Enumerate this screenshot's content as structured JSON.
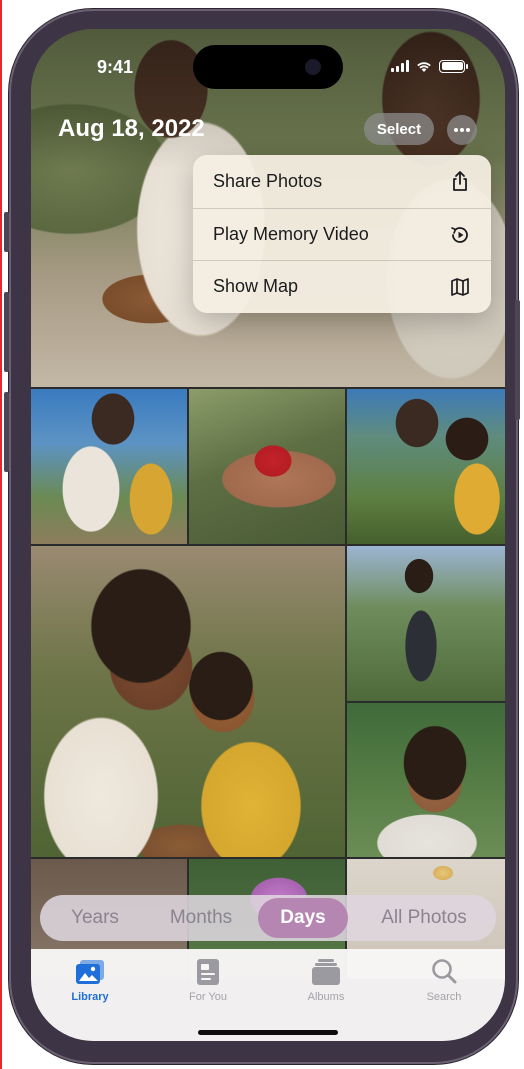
{
  "status_bar": {
    "time": "9:41"
  },
  "header": {
    "date": "Aug 18, 2022",
    "select_label": "Select"
  },
  "context_menu": {
    "items": [
      {
        "label": "Share Photos",
        "icon": "share-icon"
      },
      {
        "label": "Play Memory Video",
        "icon": "play-memory-icon"
      },
      {
        "label": "Show Map",
        "icon": "map-icon"
      }
    ]
  },
  "segmented_control": {
    "options": [
      "Years",
      "Months",
      "Days",
      "All Photos"
    ],
    "selected": "Days"
  },
  "tab_bar": {
    "items": [
      {
        "label": "Library",
        "icon": "library-icon",
        "active": true
      },
      {
        "label": "For You",
        "icon": "for-you-icon",
        "active": false
      },
      {
        "label": "Albums",
        "icon": "albums-icon",
        "active": false
      },
      {
        "label": "Search",
        "icon": "search-icon",
        "active": false
      }
    ]
  },
  "colors": {
    "accent": "#1e6fd9",
    "segment_selected": "#b686b3",
    "menu_background": "#f4eee2"
  }
}
